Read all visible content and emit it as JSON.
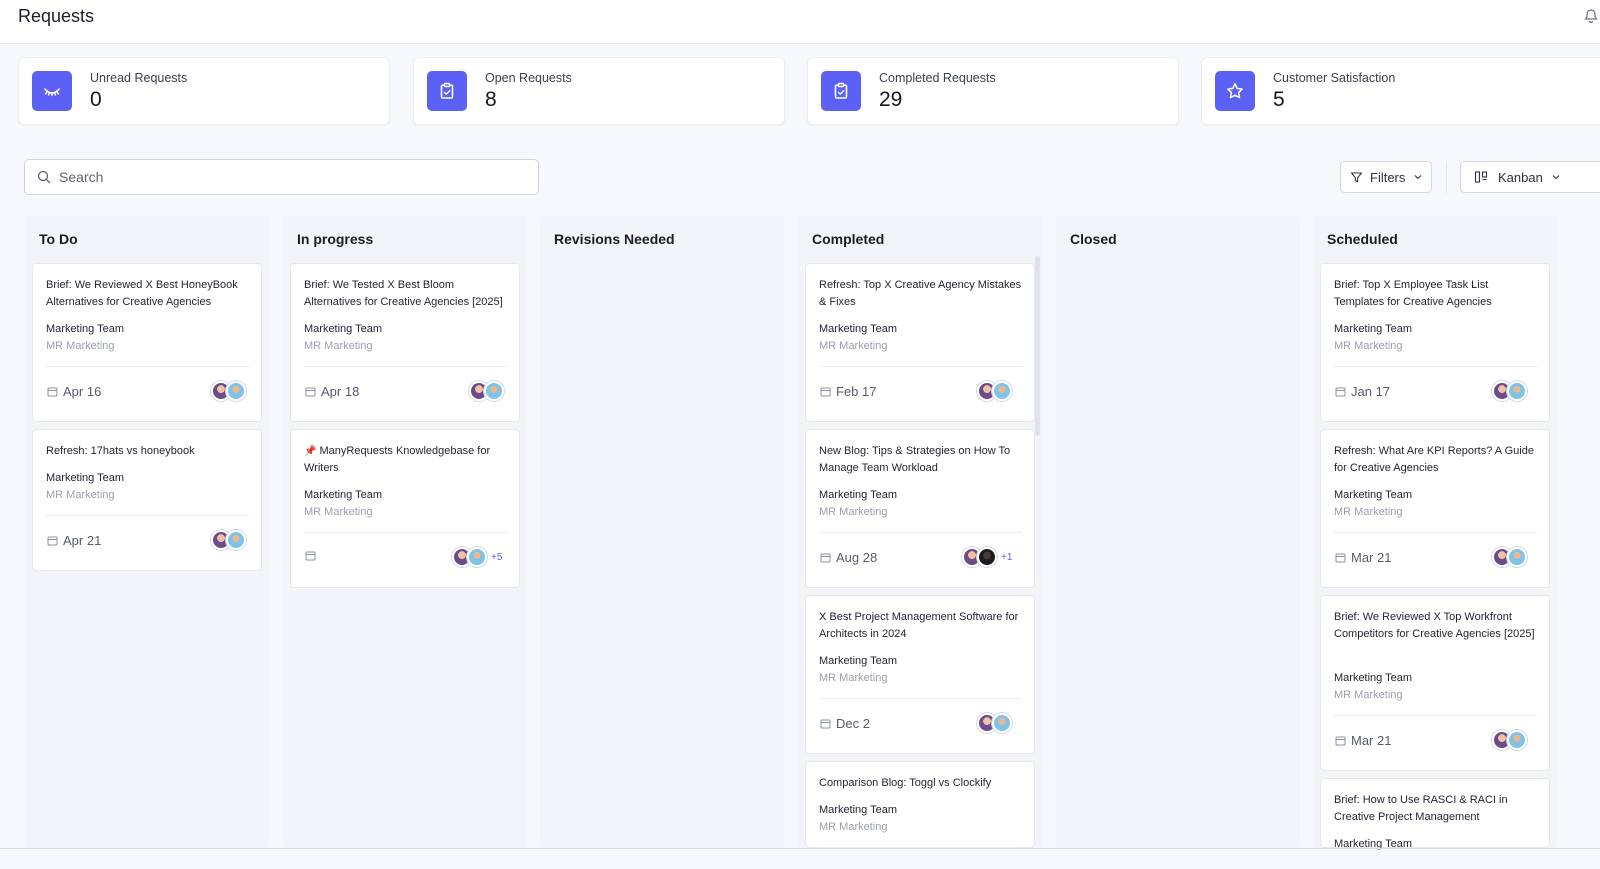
{
  "header": {
    "title": "Requests"
  },
  "stats": [
    {
      "label": "Unread Requests",
      "value": "0",
      "icon": "eye-closed-icon"
    },
    {
      "label": "Open Requests",
      "value": "8",
      "icon": "clipboard-icon"
    },
    {
      "label": "Completed Requests",
      "value": "29",
      "icon": "clipboard-check-icon"
    },
    {
      "label": "Customer Satisfaction",
      "value": "5",
      "icon": "star-icon"
    }
  ],
  "toolbar": {
    "search_placeholder": "Search",
    "filters_label": "Filters",
    "view_label": "Kanban"
  },
  "columns": [
    {
      "title": "To Do",
      "cards": [
        {
          "title": "Brief: We Reviewed X Best HoneyBook Alternatives for Creative Agencies",
          "team": "Marketing Team",
          "org": "MR Marketing",
          "date": "Apr 16"
        },
        {
          "title": "Refresh: 17hats vs honeybook",
          "team": "Marketing Team",
          "org": "MR Marketing",
          "date": "Apr 21"
        }
      ]
    },
    {
      "title": "In progress",
      "cards": [
        {
          "title": "Brief: We Tested X Best Bloom Alternatives for Creative Agencies [2025]",
          "team": "Marketing Team",
          "org": "MR Marketing",
          "date": "Apr 18"
        },
        {
          "title": "ManyRequests Knowledgebase for Writers",
          "team": "Marketing Team",
          "org": "MR Marketing",
          "date": "",
          "more": "+5"
        }
      ]
    },
    {
      "title": "Revisions Needed",
      "cards": []
    },
    {
      "title": "Completed",
      "cards": [
        {
          "title": "Refresh: Top X Creative Agency Mistakes & Fixes",
          "team": "Marketing Team",
          "org": "MR Marketing",
          "date": "Feb 17"
        },
        {
          "title": "New Blog: Tips & Strategies on How To Manage Team Workload",
          "team": "Marketing Team",
          "org": "MR Marketing",
          "date": "Aug 28",
          "more": "+1"
        },
        {
          "title": "X Best Project Management Software for Architects in 2024",
          "team": "Marketing Team",
          "org": "MR Marketing",
          "date": "Dec 2"
        },
        {
          "title": "Comparison Blog: Toggl vs Clockify",
          "team": "Marketing Team",
          "org": "MR Marketing",
          "date": ""
        }
      ]
    },
    {
      "title": "Closed",
      "cards": []
    },
    {
      "title": "Scheduled",
      "cards": [
        {
          "title": "Brief: Top X Employee Task List Templates for Creative Agencies",
          "team": "Marketing Team",
          "org": "MR Marketing",
          "date": "Jan 17"
        },
        {
          "title": "Refresh: What Are KPI Reports? A Guide for Creative Agencies",
          "team": "Marketing Team",
          "org": "MR Marketing",
          "date": "Mar 21"
        },
        {
          "title": "Brief: We Reviewed X Top Workfront Competitors for Creative Agencies [2025]",
          "team": "Marketing Team",
          "org": "MR Marketing",
          "date": "Mar 21"
        },
        {
          "title": "Brief: How to Use RASCI & RACI in Creative Project Management",
          "team": "Marketing Team",
          "org": "",
          "date": ""
        }
      ]
    }
  ],
  "colors": {
    "accent": "#5b61f5",
    "card_bg": "#ffffff",
    "column_bg": "#f3f4f8"
  }
}
